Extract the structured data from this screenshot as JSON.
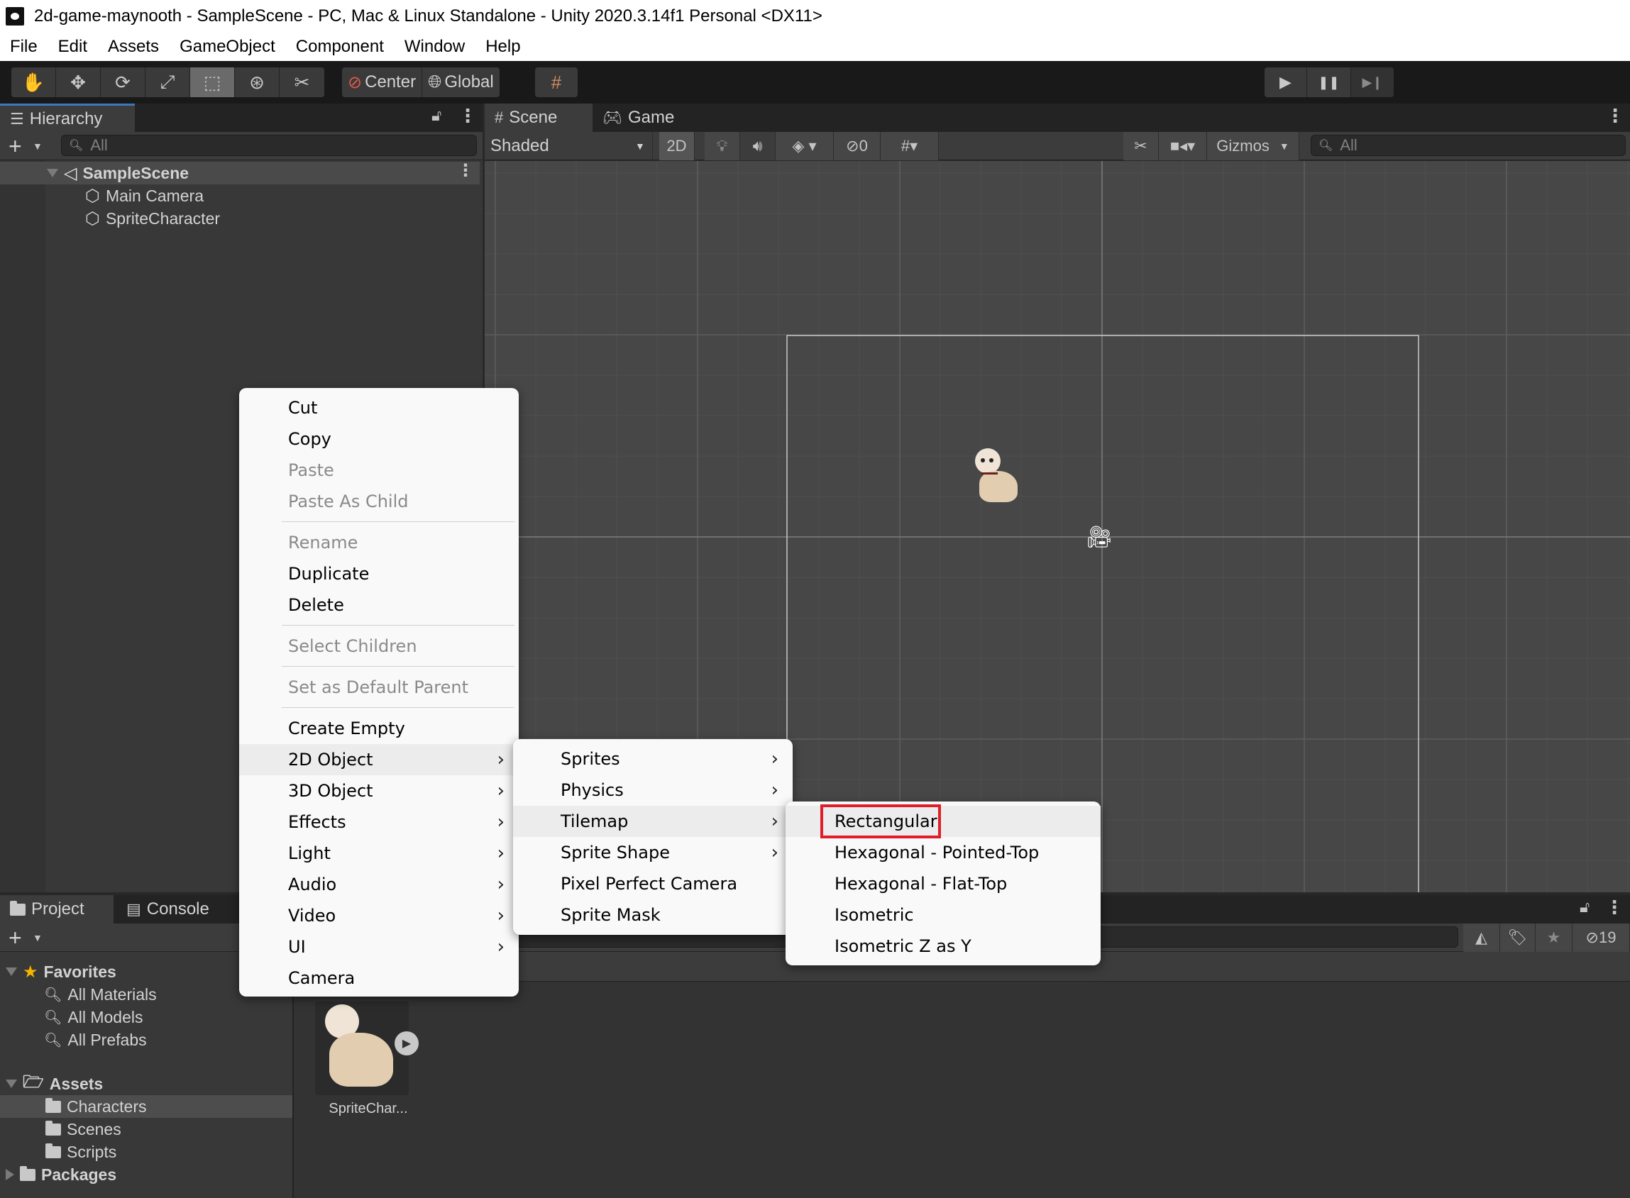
{
  "window": {
    "title": "2d-game-maynooth - SampleScene - PC, Mac & Linux Standalone - Unity 2020.3.14f1 Personal <DX11>",
    "logo_icon": "unity-logo-icon"
  },
  "menubar": [
    "File",
    "Edit",
    "Assets",
    "GameObject",
    "Component",
    "Window",
    "Help"
  ],
  "toolbar": {
    "tools": [
      {
        "name": "hand-tool",
        "glyph": "✋"
      },
      {
        "name": "move-tool",
        "glyph": "✥"
      },
      {
        "name": "rotate-tool",
        "glyph": "⟳"
      },
      {
        "name": "scale-tool",
        "glyph": "⤢"
      },
      {
        "name": "rect-tool",
        "glyph": "⬚"
      },
      {
        "name": "transform-tool",
        "glyph": "⊛"
      },
      {
        "name": "custom-tool",
        "glyph": "✂"
      }
    ],
    "active_tool": "rect-tool",
    "pivot_label": "Center",
    "space_label": "Global",
    "snap_icon": "grid-snap-icon",
    "play": {
      "play_glyph": "▶",
      "pause_glyph": "❚❚",
      "step_glyph": "▶❙"
    }
  },
  "hierarchy": {
    "tab_label": "Hierarchy",
    "search_placeholder": "All",
    "scene_name": "SampleScene",
    "items": [
      "Main Camera",
      "SpriteCharacter"
    ]
  },
  "scene_panel": {
    "tabs": [
      "Scene",
      "Game"
    ],
    "active_tab": "Scene",
    "shading_mode": "Shaded",
    "mode_2d_label": "2D",
    "hidden_count": "0",
    "gizmos_label": "Gizmos",
    "search_placeholder": "All"
  },
  "project_panel": {
    "tabs": [
      "Project",
      "Console"
    ],
    "active_tab": "Project",
    "favorites_label": "Favorites",
    "favorites": [
      "All Materials",
      "All Models",
      "All Prefabs"
    ],
    "assets_label": "Assets",
    "asset_folders": [
      "Characters",
      "Scenes",
      "Scripts"
    ],
    "selected_folder": "Characters",
    "packages_label": "Packages",
    "hidden_packages_count": "19",
    "asset_items": [
      {
        "label": "SpriteChar..."
      }
    ]
  },
  "context_menu": {
    "items": [
      {
        "label": "Cut",
        "enabled": true
      },
      {
        "label": "Copy",
        "enabled": true
      },
      {
        "label": "Paste",
        "enabled": false
      },
      {
        "label": "Paste As Child",
        "enabled": false
      },
      {
        "separator": true
      },
      {
        "label": "Rename",
        "enabled": false
      },
      {
        "label": "Duplicate",
        "enabled": true
      },
      {
        "label": "Delete",
        "enabled": true
      },
      {
        "separator": true
      },
      {
        "label": "Select Children",
        "enabled": false
      },
      {
        "separator": true
      },
      {
        "label": "Set as Default Parent",
        "enabled": false
      },
      {
        "separator": true
      },
      {
        "label": "Create Empty",
        "enabled": true
      },
      {
        "label": "2D Object",
        "enabled": true,
        "submenu": true,
        "highlighted": true
      },
      {
        "label": "3D Object",
        "enabled": true,
        "submenu": true
      },
      {
        "label": "Effects",
        "enabled": true,
        "submenu": true
      },
      {
        "label": "Light",
        "enabled": true,
        "submenu": true
      },
      {
        "label": "Audio",
        "enabled": true,
        "submenu": true
      },
      {
        "label": "Video",
        "enabled": true,
        "submenu": true
      },
      {
        "label": "UI",
        "enabled": true,
        "submenu": true
      },
      {
        "label": "Camera",
        "enabled": true
      }
    ],
    "submenu_2d": [
      {
        "label": "Sprites",
        "submenu": true
      },
      {
        "label": "Physics",
        "submenu": true
      },
      {
        "label": "Tilemap",
        "submenu": true,
        "highlighted": true
      },
      {
        "label": "Sprite Shape",
        "submenu": true
      },
      {
        "label": "Pixel Perfect Camera"
      },
      {
        "label": "Sprite Mask"
      }
    ],
    "submenu_tilemap": [
      {
        "label": "Rectangular",
        "highlighted": true,
        "annotated": true
      },
      {
        "label": "Hexagonal - Pointed-Top"
      },
      {
        "label": "Hexagonal - Flat-Top"
      },
      {
        "label": "Isometric"
      },
      {
        "label": "Isometric Z as Y"
      }
    ],
    "arrow_glyph": "›"
  },
  "colors": {
    "annotation_red": "#e01e2b",
    "accent_blue": "#3a79bb",
    "favorites_star": "#f4b400"
  }
}
